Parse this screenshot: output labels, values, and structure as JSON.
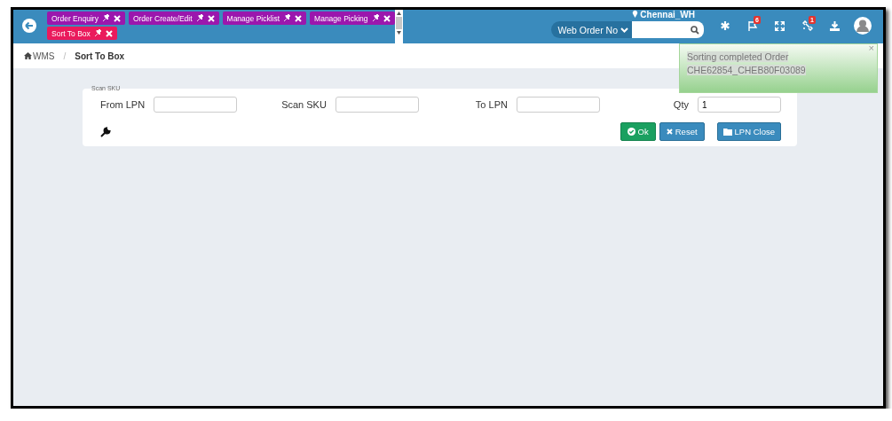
{
  "tabs": [
    {
      "label": "Order Enquiry",
      "selected": false
    },
    {
      "label": "Order Create/Edit",
      "selected": false
    },
    {
      "label": "Manage Picklist",
      "selected": false
    },
    {
      "label": "Manage Picking",
      "selected": false
    },
    {
      "label": "Sort To Box",
      "selected": true
    }
  ],
  "location": "Chennai_WH",
  "search": {
    "type_label": "Web Order No"
  },
  "header_icons": [
    {
      "kind": "asterisk"
    },
    {
      "kind": "flag",
      "badge": "6"
    },
    {
      "kind": "expand"
    },
    {
      "kind": "unlink",
      "badge": "1"
    },
    {
      "kind": "download"
    },
    {
      "kind": "avatar"
    }
  ],
  "breadcrumb": {
    "home": "WMS",
    "separator": "/",
    "current": "Sort To Box"
  },
  "form": {
    "legend": "Scan SKU",
    "fields": [
      {
        "label": "From LPN"
      },
      {
        "label": "Scan SKU"
      },
      {
        "label": "To LPN"
      },
      {
        "label": "Qty",
        "value": "1"
      }
    ],
    "buttons": [
      {
        "label": "Ok",
        "kind": "ok"
      },
      {
        "label": "Reset",
        "kind": "reset"
      },
      {
        "label": "LPN Close",
        "kind": "close"
      }
    ]
  },
  "toast": {
    "close": "×",
    "lines": [
      "Sorting completed Order",
      "CHE62854_CHEB80F03089"
    ]
  }
}
